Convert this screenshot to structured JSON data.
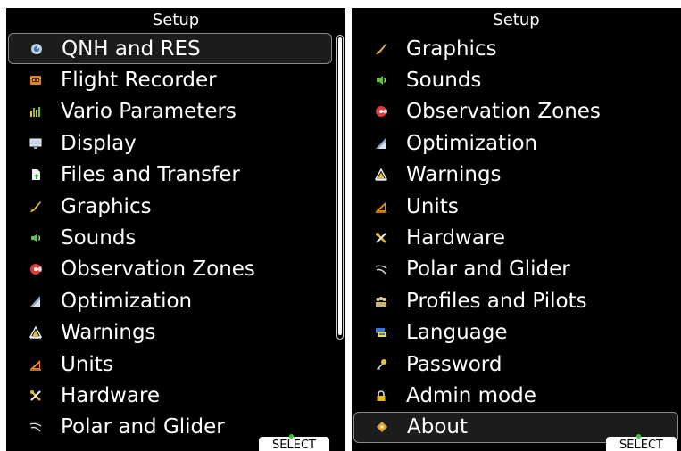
{
  "left_panel": {
    "title": "Setup",
    "items": [
      {
        "label": "QNH and RES",
        "icon": "qnh-icon",
        "selected": true
      },
      {
        "label": "Flight Recorder",
        "icon": "flight-recorder-icon"
      },
      {
        "label": "Vario Parameters",
        "icon": "vario-icon"
      },
      {
        "label": "Display",
        "icon": "display-icon"
      },
      {
        "label": "Files and Transfer",
        "icon": "files-transfer-icon"
      },
      {
        "label": "Graphics",
        "icon": "graphics-icon"
      },
      {
        "label": "Sounds",
        "icon": "sounds-icon"
      },
      {
        "label": "Observation Zones",
        "icon": "observation-zones-icon"
      },
      {
        "label": "Optimization",
        "icon": "optimization-icon"
      },
      {
        "label": "Warnings",
        "icon": "warning-icon"
      },
      {
        "label": "Units",
        "icon": "units-icon"
      },
      {
        "label": "Hardware",
        "icon": "hardware-icon"
      },
      {
        "label": "Polar and Glider",
        "icon": "glider-icon"
      }
    ],
    "select_label": "SELECT"
  },
  "right_panel": {
    "title": "Setup",
    "items": [
      {
        "label": "Graphics",
        "icon": "graphics-icon"
      },
      {
        "label": "Sounds",
        "icon": "sounds-icon"
      },
      {
        "label": "Observation Zones",
        "icon": "observation-zones-icon"
      },
      {
        "label": "Optimization",
        "icon": "optimization-icon"
      },
      {
        "label": "Warnings",
        "icon": "warning-icon"
      },
      {
        "label": "Units",
        "icon": "units-icon"
      },
      {
        "label": "Hardware",
        "icon": "hardware-icon"
      },
      {
        "label": "Polar and Glider",
        "icon": "glider-icon"
      },
      {
        "label": "Profiles and Pilots",
        "icon": "profiles-icon"
      },
      {
        "label": "Language",
        "icon": "language-icon"
      },
      {
        "label": "Password",
        "icon": "key-icon"
      },
      {
        "label": "Admin mode",
        "icon": "lock-icon"
      },
      {
        "label": "About",
        "icon": "about-icon",
        "selected": true
      }
    ],
    "select_label": "SELECT"
  },
  "colors": {
    "background": "#000000",
    "text": "#ffffff",
    "selection_border": "#8a8a8a",
    "select_indicator": "#35c935"
  }
}
